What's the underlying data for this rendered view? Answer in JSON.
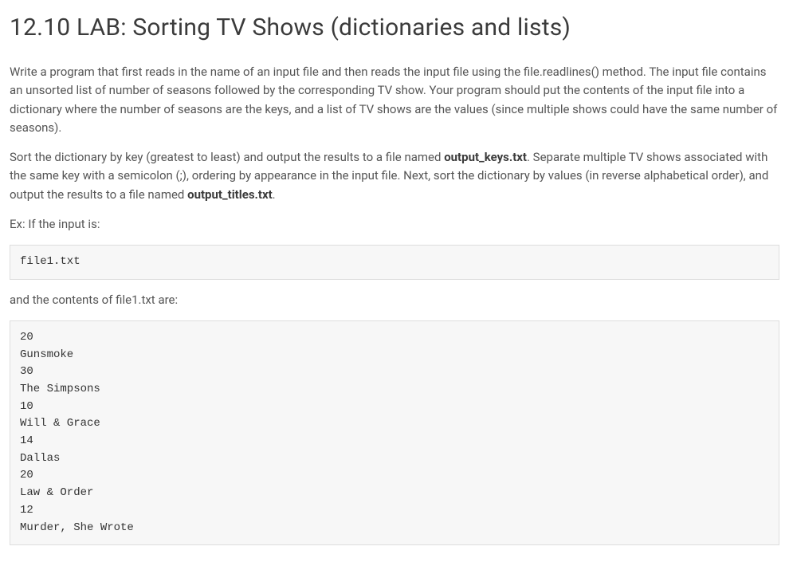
{
  "title": "12.10 LAB: Sorting TV Shows (dictionaries and lists)",
  "para1": "Write a program that first reads in the name of an input file and then reads the input file using the file.readlines() method. The input file contains an unsorted list of number of seasons followed by the corresponding TV show. Your program should put the contents of the input file into a dictionary where the number of seasons are the keys, and a list of TV shows are the values (since multiple shows could have the same number of seasons).",
  "para2_a": "Sort the dictionary by key (greatest to least) and output the results to a file named ",
  "para2_bold1": "output_keys.txt",
  "para2_b": ". Separate multiple TV shows associated with the same key with a semicolon (;), ordering by appearance in the input file. Next, sort the dictionary by values (in reverse alphabetical order), and output the results to a file named ",
  "para2_bold2": "output_titles.txt",
  "para2_c": ".",
  "para3": "Ex: If the input is:",
  "code1": "file1.txt",
  "para4": "and the contents of file1.txt are:",
  "code2": "20\nGunsmoke\n30\nThe Simpsons\n10\nWill & Grace\n14\nDallas\n20\nLaw & Order\n12\nMurder, She Wrote"
}
